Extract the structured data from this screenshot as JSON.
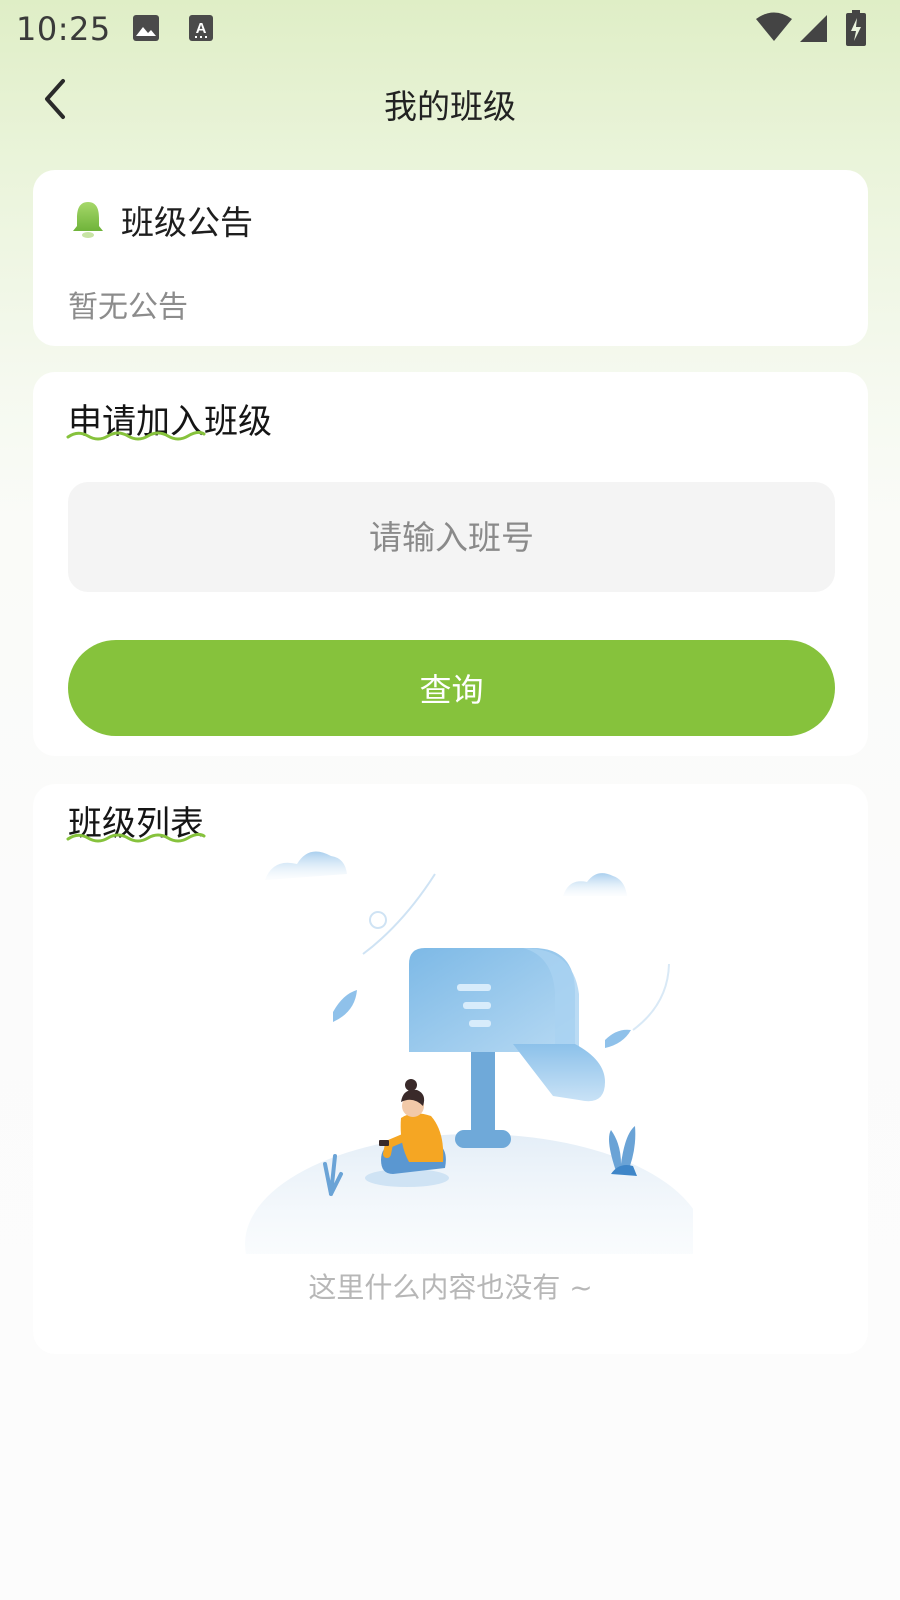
{
  "status_bar": {
    "time": "10:25",
    "icons": [
      "image-icon",
      "keyboard-a-icon",
      "wifi-icon",
      "signal-icon",
      "battery-charging-icon"
    ]
  },
  "nav": {
    "title": "我的班级",
    "back_icon": "chevron-left-icon"
  },
  "notice": {
    "title": "班级公告",
    "icon": "bell-icon",
    "content": "暂无公告"
  },
  "join": {
    "title": "申请加入班级",
    "input_placeholder": "请输入班号",
    "input_value": "",
    "button_label": "查询"
  },
  "class_list": {
    "title": "班级列表",
    "empty_text": "这里什么内容也没有 ~",
    "empty_illustration": "mailbox-empty-illustration"
  },
  "colors": {
    "accent_green": "#86c23c",
    "header_gradient_top": "#dfeec6",
    "input_bg": "#f4f4f4",
    "illustration_blue": "#7ab6e4",
    "illustration_orange": "#f5a623"
  }
}
